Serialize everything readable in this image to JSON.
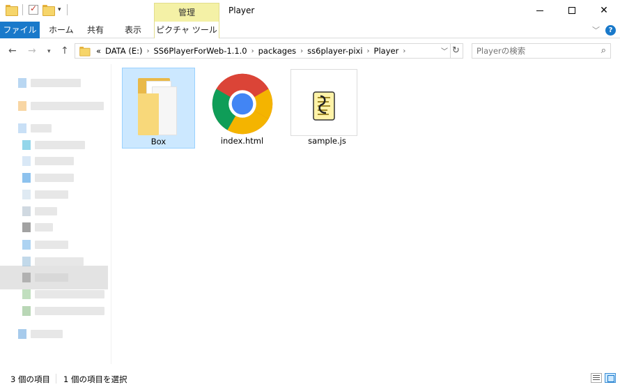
{
  "window": {
    "title": "Player",
    "context_tab_group": "管理"
  },
  "ribbon": {
    "tabs": [
      {
        "label": "ファイル",
        "active": true
      },
      {
        "label": "ホーム"
      },
      {
        "label": "共有"
      },
      {
        "label": "表示"
      },
      {
        "label": "ピクチャ ツール"
      }
    ]
  },
  "address_bar": {
    "overflow": "«",
    "breadcrumbs": [
      "DATA (E:)",
      "SS6PlayerForWeb-1.1.0",
      "packages",
      "ss6player-pixi",
      "Player"
    ]
  },
  "search": {
    "placeholder": "Playerの検索"
  },
  "files": [
    {
      "name": "Box",
      "type": "folder",
      "selected": true,
      "icon": "folder-icon"
    },
    {
      "name": "index.html",
      "type": "html",
      "selected": false,
      "icon": "chrome-icon"
    },
    {
      "name": "sample.js",
      "type": "js",
      "selected": false,
      "icon": "script-icon"
    }
  ],
  "status": {
    "item_count": "3 個の項目",
    "selected_count": "1 個の項目を選択"
  },
  "colors": {
    "file_tab": "#1979ca",
    "manage_tab": "#f4f1a6",
    "selection": "#cce8ff"
  }
}
